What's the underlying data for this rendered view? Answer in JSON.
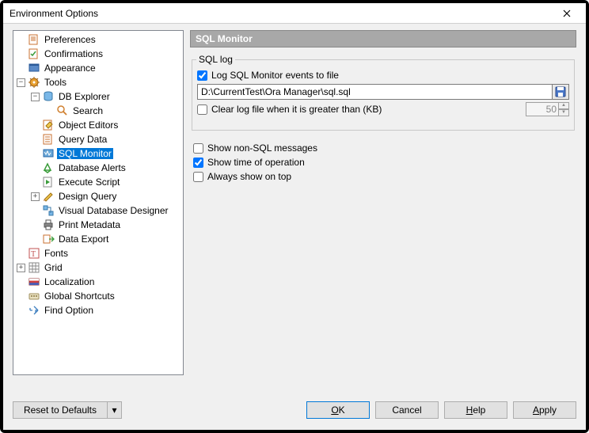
{
  "window": {
    "title": "Environment Options"
  },
  "tree": {
    "preferences": "Preferences",
    "confirmations": "Confirmations",
    "appearance": "Appearance",
    "tools": "Tools",
    "db_explorer": "DB Explorer",
    "search": "Search",
    "object_editors": "Object Editors",
    "query_data": "Query Data",
    "sql_monitor": "SQL Monitor",
    "database_alerts": "Database Alerts",
    "execute_script": "Execute Script",
    "design_query": "Design Query",
    "visual_db_designer": "Visual Database Designer",
    "print_metadata": "Print Metadata",
    "data_export": "Data Export",
    "fonts": "Fonts",
    "grid": "Grid",
    "localization": "Localization",
    "global_shortcuts": "Global Shortcuts",
    "find_option": "Find Option"
  },
  "panel": {
    "header": "SQL Monitor",
    "fieldset": "SQL log",
    "log_events": "Log SQL Monitor events to file",
    "path": "D:\\CurrentTest\\Ora Manager\\sql.sql",
    "clear_log": "Clear log file when it is greater than (KB)",
    "kb_value": "50",
    "show_non_sql": "Show non-SQL messages",
    "show_time": "Show time of operation",
    "always_top": "Always show on top"
  },
  "buttons": {
    "reset": "Reset to Defaults",
    "dd": "▾",
    "ok_u": "O",
    "ok_rest": "K",
    "cancel": "Cancel",
    "help_u": "H",
    "help_rest": "elp",
    "apply_u": "A",
    "apply_rest": "pply"
  }
}
